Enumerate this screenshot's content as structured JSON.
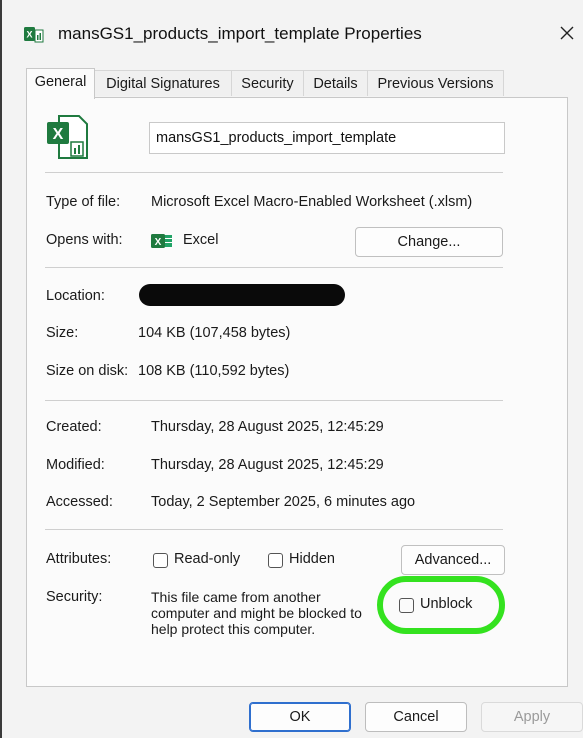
{
  "window": {
    "title": "mansGS1_products_import_template Properties",
    "close_icon": "close-icon",
    "title_icon": "excel-macro-file-icon"
  },
  "tabs": [
    {
      "label": "General",
      "active": true
    },
    {
      "label": "Digital Signatures",
      "active": false
    },
    {
      "label": "Security",
      "active": false
    },
    {
      "label": "Details",
      "active": false
    },
    {
      "label": "Previous Versions",
      "active": false
    }
  ],
  "general": {
    "file_name": "mansGS1_products_import_template",
    "type_label": "Type of file:",
    "type_value": "Microsoft Excel Macro-Enabled Worksheet (.xlsm)",
    "opens_label": "Opens with:",
    "opens_value": "Excel",
    "change_button": "Change...",
    "location_label": "Location:",
    "size_label": "Size:",
    "size_value": "104 KB (107,458 bytes)",
    "size_disk_label": "Size on disk:",
    "size_disk_value": "108 KB (110,592 bytes)",
    "created_label": "Created:",
    "created_value": "Thursday, 28 August 2025, 12:45:29",
    "modified_label": "Modified:",
    "modified_value": "Thursday, 28 August 2025, 12:45:29",
    "accessed_label": "Accessed:",
    "accessed_value": "Today, 2 September 2025, 6 minutes ago",
    "attributes_label": "Attributes:",
    "readonly_label": "Read-only",
    "readonly_checked": false,
    "hidden_label": "Hidden",
    "hidden_checked": false,
    "advanced_button": "Advanced...",
    "security_label": "Security:",
    "security_line1": "This file came from another",
    "security_line2": "computer and might be blocked to",
    "security_line3": "help protect this computer.",
    "unblock_label": "Unblock",
    "unblock_checked": false
  },
  "footer": {
    "ok": "OK",
    "cancel": "Cancel",
    "apply": "Apply"
  },
  "colors": {
    "highlight": "#34e21f",
    "excel_green": "#1f7a3f",
    "primary_border": "#2f6fce"
  }
}
